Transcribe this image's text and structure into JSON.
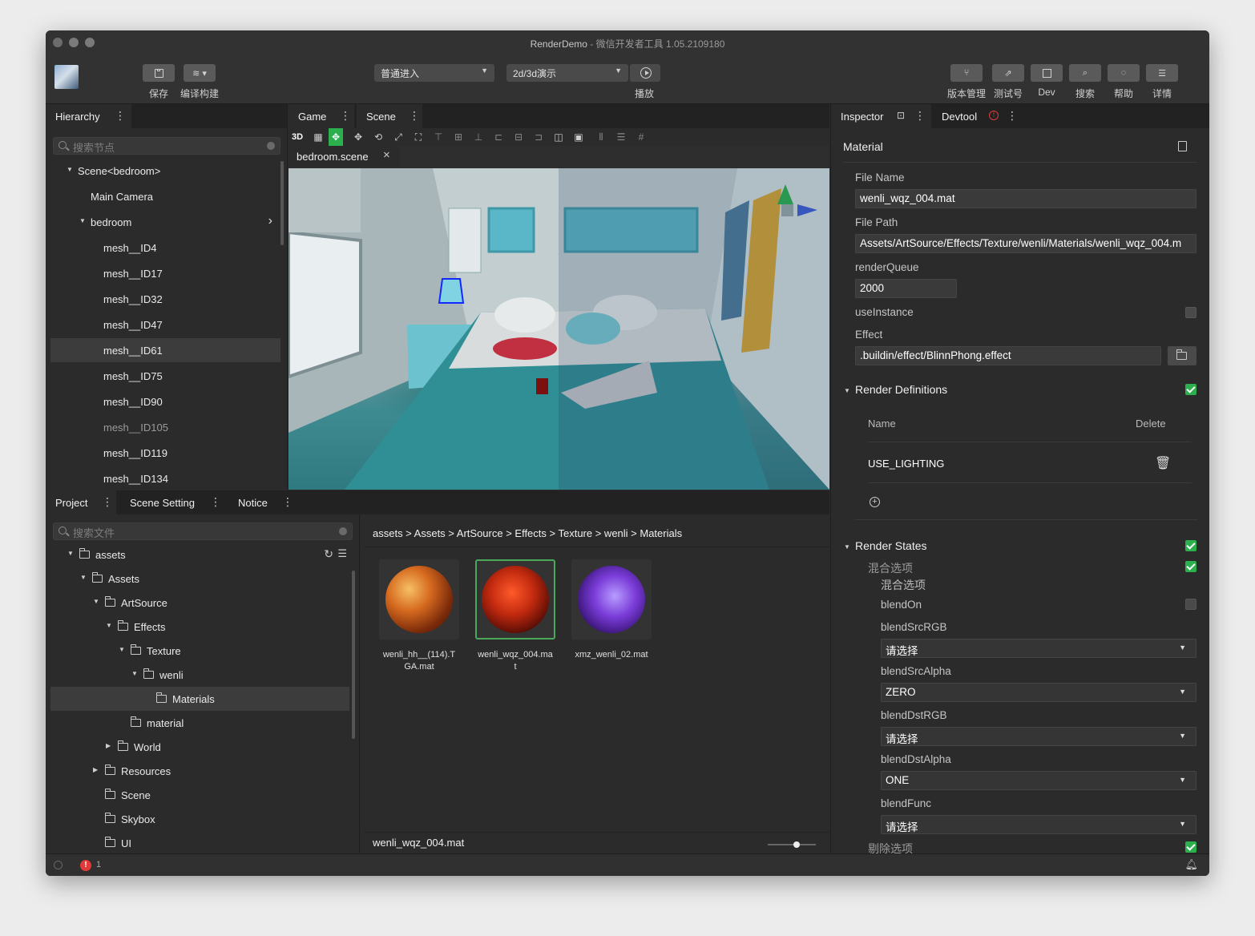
{
  "window": {
    "title_app": "RenderDemo",
    "title_sep": " - ",
    "title_tool": "微信开发者工具 1.05.2109180"
  },
  "toolbar": {
    "save_label": "保存",
    "build_label": "编译构建",
    "mode_select": "普通进入",
    "demo_select": "2d/3d演示",
    "play_label": "播放",
    "right_buttons": [
      {
        "label": "版本管理",
        "icon": "branch-icon"
      },
      {
        "label": "测试号",
        "icon": "external-link-icon"
      },
      {
        "label": "Dev",
        "icon": "dev-icon"
      },
      {
        "label": "搜索",
        "icon": "search-icon"
      },
      {
        "label": "帮助",
        "icon": "help-bubble-icon"
      },
      {
        "label": "详情",
        "icon": "menu-icon"
      }
    ]
  },
  "hierarchy": {
    "tab": "Hierarchy",
    "search_placeholder": "搜索节点",
    "nodes": [
      {
        "label": "Scene<bedroom>",
        "expanded": true
      },
      {
        "label": "Main Camera"
      },
      {
        "label": "bedroom",
        "expanded": true
      },
      {
        "label": "mesh__ID4"
      },
      {
        "label": "mesh__ID17"
      },
      {
        "label": "mesh__ID32"
      },
      {
        "label": "mesh__ID47"
      },
      {
        "label": "mesh__ID61",
        "selected": true
      },
      {
        "label": "mesh__ID75"
      },
      {
        "label": "mesh__ID90"
      },
      {
        "label": "mesh__ID105",
        "dim": true
      },
      {
        "label": "mesh__ID119"
      },
      {
        "label": "mesh__ID134"
      }
    ]
  },
  "scene_panel": {
    "tabs": [
      "Game",
      "Scene"
    ],
    "view_mode": "3D",
    "file_tab": "bedroom.scene"
  },
  "project": {
    "tabs": [
      "Project",
      "Scene Setting",
      "Notice"
    ],
    "search_placeholder": "搜索文件",
    "tree": [
      {
        "label": "assets",
        "expanded": true
      },
      {
        "label": "Assets",
        "expanded": true
      },
      {
        "label": "ArtSource",
        "expanded": true
      },
      {
        "label": "Effects",
        "expanded": true
      },
      {
        "label": "Texture",
        "expanded": true
      },
      {
        "label": "wenli",
        "expanded": true
      },
      {
        "label": "Materials",
        "selected": true
      },
      {
        "label": "material"
      },
      {
        "label": "World",
        "expanded": false
      },
      {
        "label": "Resources",
        "expanded": false
      },
      {
        "label": "Scene"
      },
      {
        "label": "Skybox"
      },
      {
        "label": "UI"
      }
    ],
    "breadcrumb": "assets > Assets > ArtSource > Effects > Texture > wenli > Materials",
    "files": [
      {
        "name_line1": "wenli_hh__(114).T",
        "name_line2": "GA.mat"
      },
      {
        "name_line1": "wenli_wqz_004.ma",
        "name_line2": "t",
        "selected": true
      },
      {
        "name_line1": "xmz_wenli_02.mat",
        "name_line2": ""
      }
    ],
    "footer_file": "wenli_wqz_004.mat",
    "zoom": 0.6
  },
  "inspector": {
    "tabs": [
      "Inspector",
      "Devtool"
    ],
    "section": "Material",
    "file_name_label": "File Name",
    "file_name": "wenli_wqz_004.mat",
    "file_path_label": "File Path",
    "file_path": "Assets/ArtSource/Effects/Texture/wenli/Materials/wenli_wqz_004.m",
    "render_queue_label": "renderQueue",
    "render_queue": "2000",
    "use_instance_label": "useInstance",
    "effect_label": "Effect",
    "effect": ".buildin/effect/BlinnPhong.effect",
    "render_definitions": {
      "title": "Render Definitions",
      "col_name": "Name",
      "col_delete": "Delete",
      "items": [
        "USE_LIGHTING"
      ]
    },
    "render_states": {
      "title": "Render States",
      "blend_group": "混合选项",
      "blend_sub": "混合选项",
      "blend_on_label": "blendOn",
      "fields": [
        {
          "label": "blendSrcRGB",
          "value": "请选择"
        },
        {
          "label": "blendSrcAlpha",
          "value": "ZERO"
        },
        {
          "label": "blendDstRGB",
          "value": "请选择"
        },
        {
          "label": "blendDstAlpha",
          "value": "ONE"
        },
        {
          "label": "blendFunc",
          "value": "请选择"
        }
      ],
      "cull_group": "剔除选项"
    }
  },
  "statusbar": {
    "error_count": "1"
  },
  "colors": {
    "accent_green": "#2cb04d",
    "error_red": "#e03a3a"
  }
}
